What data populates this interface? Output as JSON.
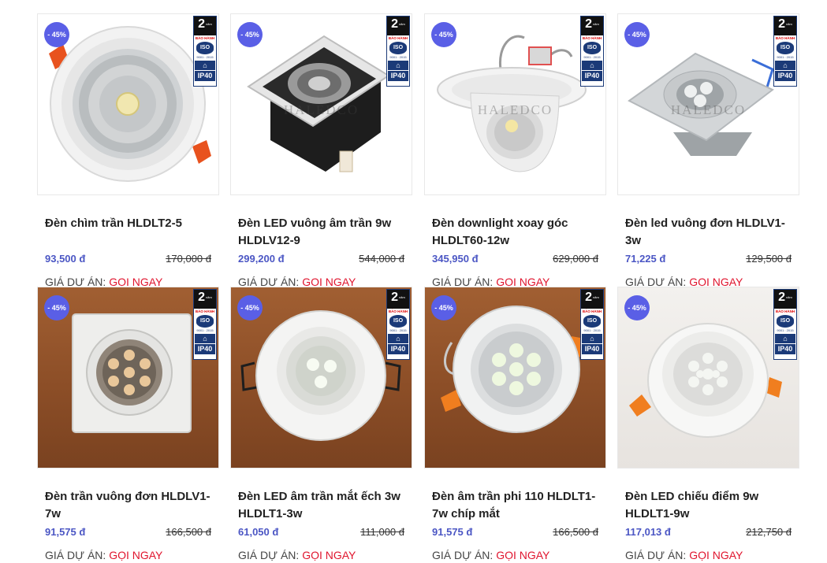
{
  "badge": {
    "years": "2",
    "years_unit": "năm",
    "warranty": "BẢO HÀNH",
    "iso": "ISO",
    "iso_number": "9001 : 2015",
    "ip": "IP40"
  },
  "watermark": "HALEDCO",
  "project_label": "GIÁ DỰ ÁN:",
  "call_label": "GỌI NGAY",
  "products": [
    {
      "discount": "- 45%",
      "name": "Đèn chìm trần HLDLT2-5",
      "price": "93,500 đ",
      "old_price": "170,000 đ",
      "image_icon": "round-cob-downlight-icon",
      "watermark": false
    },
    {
      "discount": "- 45%",
      "name": "Đèn LED vuông âm trần 9w HLDLV12-9",
      "price": "299,200 đ",
      "old_price": "544,000 đ",
      "image_icon": "square-grille-downlight-icon",
      "watermark": true
    },
    {
      "discount": "- 45%",
      "name": "Đèn downlight xoay góc HLDLT60-12w",
      "price": "345,950 đ",
      "old_price": "629,000 đ",
      "image_icon": "rotating-downlight-icon",
      "watermark": true
    },
    {
      "discount": "- 45%",
      "name": "Đèn led vuông đơn HLDLV1-3w",
      "price": "71,225 đ",
      "old_price": "129,500 đ",
      "image_icon": "square-silver-downlight-icon",
      "watermark": true
    },
    {
      "discount": "- 45%",
      "name": "Đèn trần vuông đơn HLDLV1-7w",
      "price": "91,575 đ",
      "old_price": "166,500 đ",
      "image_icon": "square-white-downlight-icon",
      "watermark": false
    },
    {
      "discount": "- 45%",
      "name": "Đèn LED âm trần mắt ếch 3w HLDLT1-3w",
      "price": "61,050 đ",
      "old_price": "111,000 đ",
      "image_icon": "round-frog-eye-downlight-icon",
      "watermark": false
    },
    {
      "discount": "- 45%",
      "name": "Đèn âm trần phi 110 HLDLT1-7w chíp mắt",
      "price": "91,575 đ",
      "old_price": "166,500 đ",
      "image_icon": "round-7-chip-downlight-icon",
      "watermark": false
    },
    {
      "discount": "- 45%",
      "name": "Đèn LED chiếu điểm 9w HLDLT1-9w",
      "price": "117,013 đ",
      "old_price": "212,750 đ",
      "image_icon": "round-spotlight-icon",
      "watermark": false
    }
  ]
}
